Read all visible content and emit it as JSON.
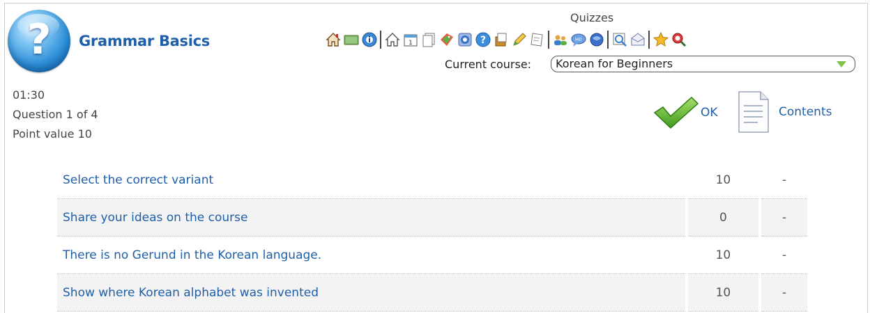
{
  "header": {
    "app_title": "Grammar Basics",
    "section_title": "Quizzes",
    "course_label": "Current course:",
    "course_value": "Korean for Beginners"
  },
  "toolbar": {
    "icons": [
      "home-icon",
      "board-icon",
      "globe-info-icon",
      "home-icon-2",
      "calendar-icon",
      "documents-icon",
      "tags-icon",
      "web-icon",
      "help-icon",
      "archive-icon",
      "edit-icon",
      "notes-icon",
      "users-icon",
      "chat-icon",
      "forum-icon",
      "search-icon",
      "mail-icon",
      "favorites-icon",
      "search-red-icon"
    ]
  },
  "quiz_info": {
    "timer": "01:30",
    "question": "Question 1 of 4",
    "points": "Point value 10"
  },
  "actions": {
    "ok_label": "OK",
    "contents_label": "Contents"
  },
  "questions": [
    {
      "title": "Select the correct variant",
      "points": "10",
      "status": "-"
    },
    {
      "title": "Share your ideas on the course",
      "points": "0",
      "status": "-"
    },
    {
      "title": "There is no Gerund in the Korean language.",
      "points": "10",
      "status": "-"
    },
    {
      "title": "Show where Korean alphabet was invented",
      "points": "10",
      "status": "-"
    }
  ],
  "colors": {
    "accent": "#1f5fa8",
    "check_green": "#6cbf2f"
  }
}
